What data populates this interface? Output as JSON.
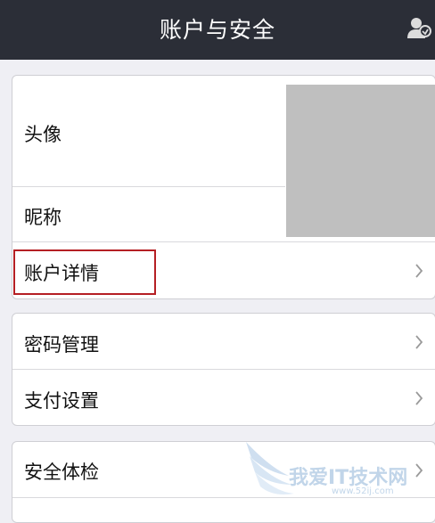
{
  "header": {
    "title": "账户与安全",
    "icon": "account-switch-icon"
  },
  "groups": [
    {
      "rows": [
        {
          "label": "头像",
          "icon": "avatar-image"
        },
        {
          "label": "昵称"
        },
        {
          "label": "账户详情",
          "icon": "chevron-right-icon"
        }
      ]
    },
    {
      "rows": [
        {
          "label": "密码管理",
          "icon": "chevron-right-icon"
        },
        {
          "label": "支付设置",
          "icon": "chevron-right-icon"
        }
      ]
    },
    {
      "rows": [
        {
          "label": "安全体检",
          "icon": "chevron-right-icon"
        }
      ]
    }
  ],
  "annotation": {
    "highlight_color": "#b51f24"
  },
  "watermark": {
    "text": "我爱IT技术网",
    "url": "www.52ij.com"
  },
  "colors": {
    "header_bg": "#2b2e37",
    "page_bg": "#efeff4",
    "avatar_placeholder": "#bfbfbf"
  }
}
